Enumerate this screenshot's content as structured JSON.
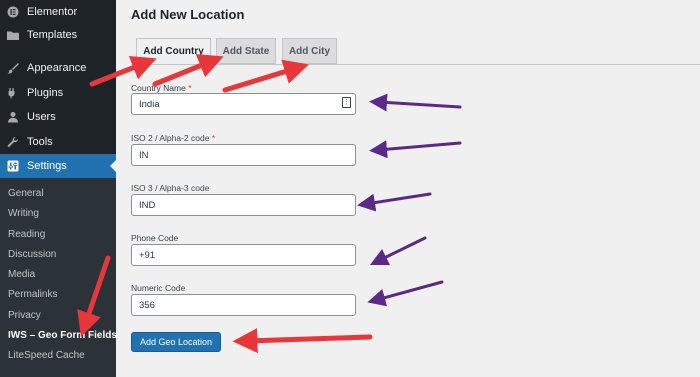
{
  "sidebar": {
    "menu": [
      {
        "label": "Elementor",
        "icon": "elementor-icon"
      },
      {
        "label": "Templates",
        "icon": "folder-icon"
      },
      {
        "label": "Appearance",
        "icon": "paintbrush-icon"
      },
      {
        "label": "Plugins",
        "icon": "plugin-icon"
      },
      {
        "label": "Users",
        "icon": "user-icon"
      },
      {
        "label": "Tools",
        "icon": "wrench-icon"
      },
      {
        "label": "Settings",
        "icon": "settings-icon"
      }
    ],
    "submenu": [
      "General",
      "Writing",
      "Reading",
      "Discussion",
      "Media",
      "Permalinks",
      "Privacy",
      "IWS – Geo Form Fields",
      "LiteSpeed Cache"
    ]
  },
  "page": {
    "title": "Add New Location",
    "tabs": [
      "Add Country",
      "Add State",
      "Add City"
    ]
  },
  "form": {
    "country_name": {
      "label": "Country Name",
      "required_mark": "*",
      "value": "India"
    },
    "iso2": {
      "label": "ISO 2 / Alpha-2 code",
      "required_mark": "*",
      "value": "IN"
    },
    "iso3": {
      "label": "ISO 3 / Alpha-3 code",
      "value": "IND"
    },
    "phone_code": {
      "label": "Phone Code",
      "value": "+91"
    },
    "numeric_code": {
      "label": "Numeric Code",
      "value": "356"
    },
    "submit_label": "Add Geo Location"
  },
  "colors": {
    "sidebar_bg": "#1d2327",
    "submenu_bg": "#2c3338",
    "accent": "#2271b1",
    "annotation_red": "#e8363b",
    "annotation_purple": "#5b2a86"
  }
}
